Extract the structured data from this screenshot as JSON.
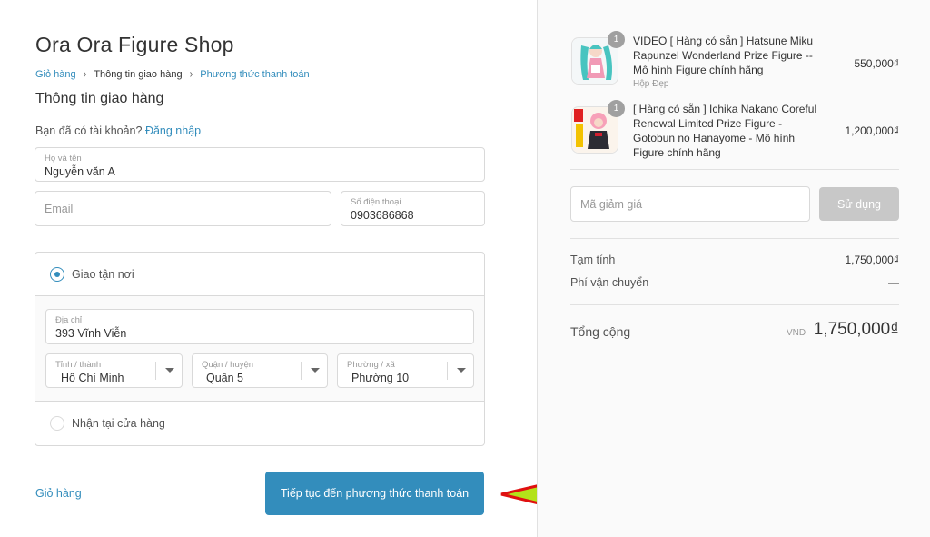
{
  "shop": {
    "title": "Ora Ora Figure Shop"
  },
  "breadcrumb": {
    "cart": "Giỏ hàng",
    "current": "Thông tin giao hàng",
    "payment": "Phương thức thanh toán",
    "sep": "›"
  },
  "section": {
    "title": "Thông tin giao hàng"
  },
  "login": {
    "prompt": "Bạn đã có tài khoản?",
    "link": "Đăng nhập"
  },
  "form": {
    "name": {
      "label": "Họ và tên",
      "value": "Nguyễn văn A"
    },
    "email": {
      "placeholder": "Email"
    },
    "phone": {
      "label": "Số điện thoại",
      "value": "0903686868"
    }
  },
  "shipping": {
    "delivery_label": "Giao tận nơi",
    "address": {
      "label": "Địa chỉ",
      "value": "393 Vĩnh Viễn"
    },
    "province": {
      "label": "Tỉnh / thành",
      "value": "Hồ Chí Minh"
    },
    "district": {
      "label": "Quận / huyện",
      "value": "Quận 5"
    },
    "ward": {
      "label": "Phường / xã",
      "value": "Phường 10"
    },
    "pickup_label": "Nhận tại cửa hàng"
  },
  "footer": {
    "back_label": "Giỏ hàng",
    "continue_label": "Tiếp tục đến phương thức thanh toán"
  },
  "order": {
    "items": [
      {
        "qty": "1",
        "name_lines": [
          "VIDEO [ Hàng có sẵn ] Hatsune Miku",
          "Rapunzel Wonderland Prize Figure --",
          "Mô hình Figure chính hãng"
        ],
        "variant": "Hộp Đẹp",
        "price": "550,000₫"
      },
      {
        "qty": "1",
        "name_lines": [
          "[ Hàng có sẵn ] Ichika Nakano Coreful",
          "Renewal Limited Prize Figure -",
          "Gotobun no Hanayome - Mô hình",
          "Figure chính hãng"
        ],
        "price": "1,200,000₫"
      }
    ],
    "discount": {
      "placeholder": "Mã giảm giá",
      "button": "Sử dụng"
    },
    "subtotal": {
      "label": "Tạm tính",
      "value": "1,750,000₫"
    },
    "shipping_fee": {
      "label": "Phí vận chuyển",
      "value": "—"
    },
    "total": {
      "label": "Tổng cộng",
      "currency": "VND",
      "value": "1,750,000₫"
    }
  },
  "colors": {
    "accent": "#338dbc",
    "arrow_fill": "#b3e21a",
    "arrow_stroke": "#e01010",
    "disabled": "#c8c8c8"
  }
}
